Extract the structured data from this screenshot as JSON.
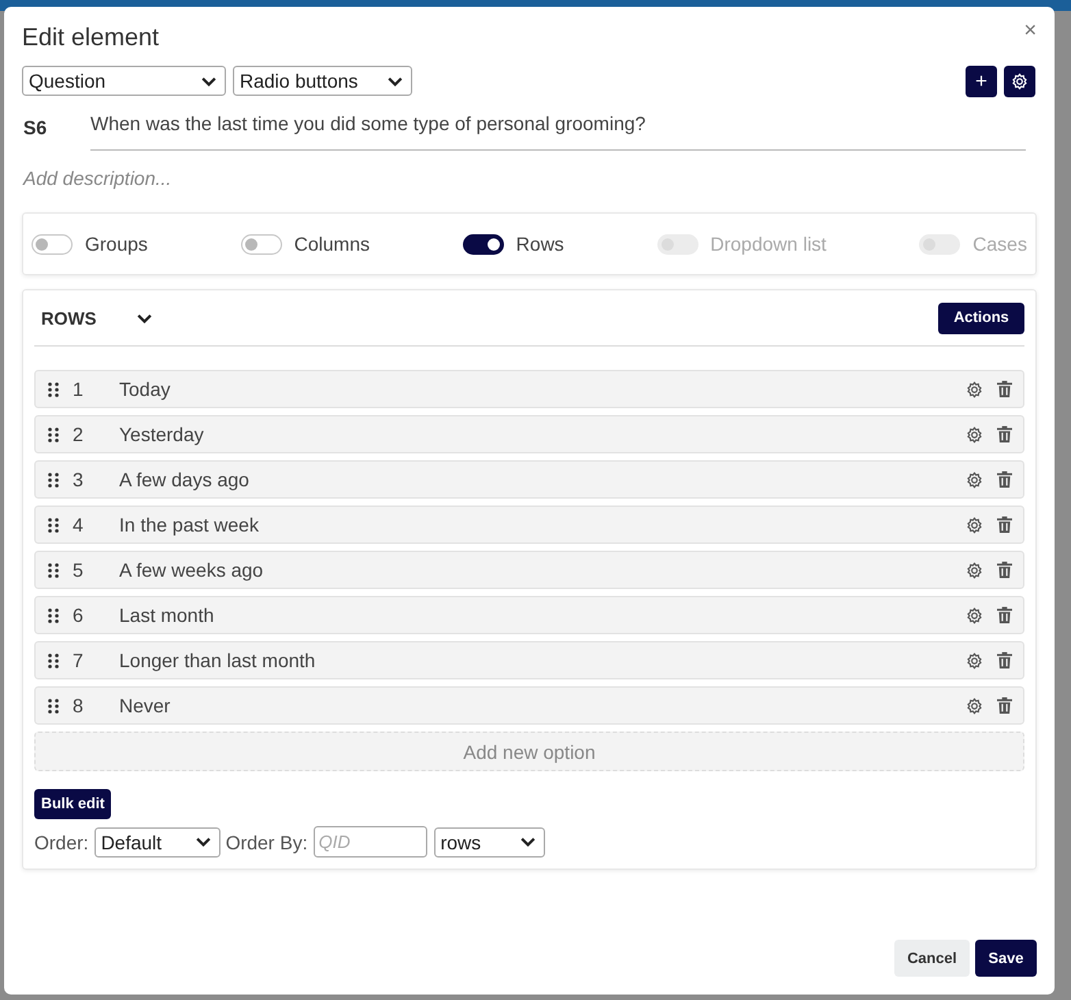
{
  "dialog": {
    "title": "Edit element",
    "close": "×"
  },
  "selects": [
    {
      "value": "Question"
    },
    {
      "value": "Radio buttons"
    }
  ],
  "toolbar": {
    "add": "+"
  },
  "question": {
    "id": "S6",
    "text": "When was the last time you did some type of personal grooming?"
  },
  "description": {
    "placeholder": "Add description..."
  },
  "toggles": [
    {
      "label": "Groups",
      "on": false,
      "disabled": false
    },
    {
      "label": "Columns",
      "on": false,
      "disabled": false
    },
    {
      "label": "Rows",
      "on": true,
      "disabled": false
    },
    {
      "label": "Dropdown list",
      "on": false,
      "disabled": true
    },
    {
      "label": "Cases",
      "on": false,
      "disabled": true
    }
  ],
  "rows_panel": {
    "title": "ROWS",
    "actions": "Actions",
    "rows": [
      {
        "number": "1",
        "label": "Today"
      },
      {
        "number": "2",
        "label": "Yesterday"
      },
      {
        "number": "3",
        "label": "A few days ago"
      },
      {
        "number": "4",
        "label": "In the past week"
      },
      {
        "number": "5",
        "label": "A few weeks ago"
      },
      {
        "number": "6",
        "label": "Last month"
      },
      {
        "number": "7",
        "label": "Longer than last month"
      },
      {
        "number": "8",
        "label": "Never"
      }
    ],
    "add_option": "Add new option",
    "bulk_edit": "Bulk edit",
    "order_label": "Order:",
    "order_value": "Default",
    "order_by_label": "Order By:",
    "order_by_placeholder": "QID",
    "order_by_value": "rows"
  },
  "buttons": {
    "cancel": "Cancel",
    "save": "Save"
  }
}
